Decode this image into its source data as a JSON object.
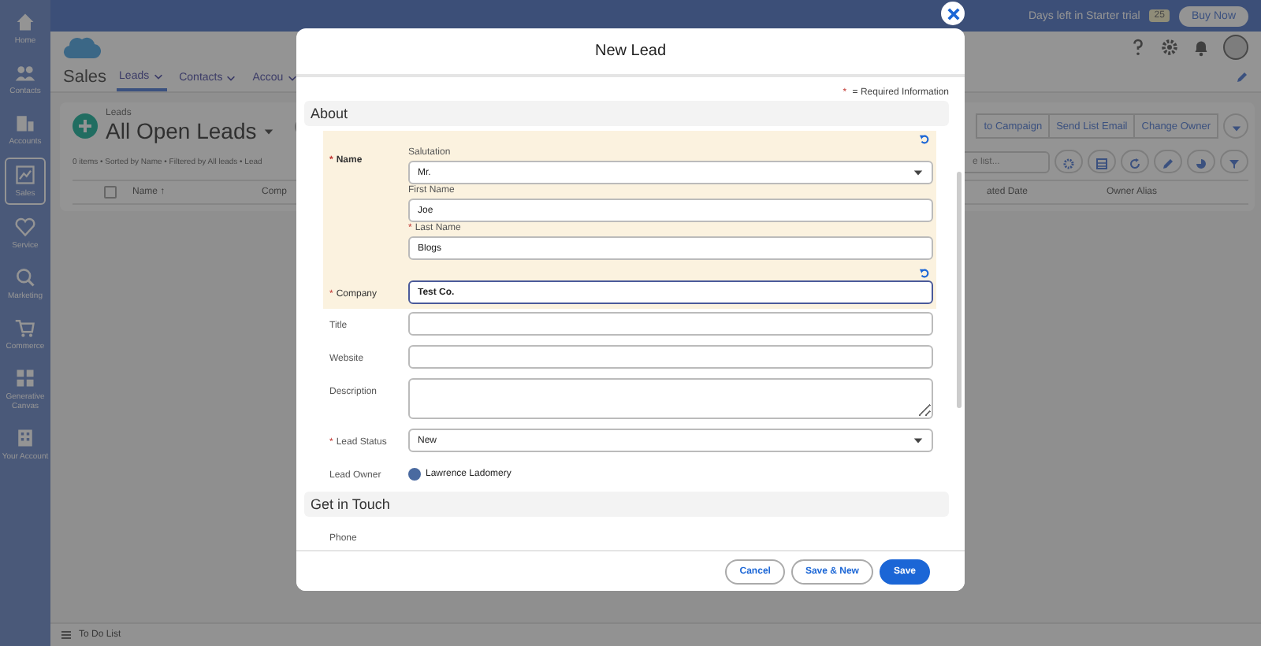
{
  "top_bar": {
    "trial_text": "Days left in Starter trial",
    "days": "25",
    "buy_button": "Buy Now"
  },
  "nav": {
    "items": [
      {
        "label": "Home",
        "selected": false
      },
      {
        "label": "Contacts",
        "selected": false
      },
      {
        "label": "Accounts",
        "selected": false
      },
      {
        "label": "Sales",
        "selected": true
      },
      {
        "label": "Service",
        "selected": false
      },
      {
        "label": "Marketing",
        "selected": false
      },
      {
        "label": "Commerce",
        "selected": false
      },
      {
        "label": "Generative Canvas",
        "selected": false
      },
      {
        "label": "Your Account",
        "selected": false
      }
    ]
  },
  "app": {
    "name": "Sales",
    "tabs": [
      {
        "label": "Leads",
        "selected": true
      },
      {
        "label": "Contacts",
        "selected": false
      },
      {
        "label": "Accou",
        "selected": false
      }
    ]
  },
  "list_view": {
    "object": "Leads",
    "title": "All Open Leads",
    "summary": "0 items • Sorted by Name • Filtered by All leads • Lead",
    "actions": [
      "to Campaign",
      "Send List Email",
      "Change Owner"
    ],
    "search": {
      "placeholder": "e list..."
    },
    "select_all": {
      "checked": false
    },
    "columns_left": [
      "Name ↑",
      "Comp"
    ],
    "columns_right": [
      "ated Date",
      "Owner Alias"
    ]
  },
  "modal": {
    "title": "New Lead",
    "required_note": {
      "mark": "*",
      "text": "= Required Information"
    },
    "sections": [
      {
        "title": "About",
        "fields": [
          {
            "kind": "compound",
            "label": "Name",
            "required_mark": "*",
            "edited": true,
            "subfields": [
              {
                "kind": "select",
                "label": "Salutation",
                "value": "Mr."
              },
              {
                "kind": "text",
                "label": "First Name",
                "value": "Joe"
              },
              {
                "kind": "text",
                "label": "Last Name",
                "required_mark": "*",
                "value": "Blogs"
              }
            ]
          },
          {
            "kind": "text",
            "label": "Company",
            "required_mark": "*",
            "value": "Test Co.",
            "edited": true,
            "focused": true
          },
          {
            "kind": "text",
            "label": "Title",
            "edited": false
          },
          {
            "kind": "text",
            "label": "Website",
            "edited": false
          },
          {
            "kind": "textarea",
            "label": "Description",
            "edited": false
          },
          {
            "kind": "select",
            "label": "Lead Status",
            "required_mark": "*",
            "value": "New",
            "edited": false
          },
          {
            "kind": "user",
            "label": "Lead Owner",
            "value": "Lawrence Ladomery",
            "edited": false
          }
        ]
      },
      {
        "title": "Get in Touch",
        "fields": [
          {
            "kind": "label_only",
            "label": "Phone",
            "edited": false
          }
        ]
      }
    ],
    "buttons": [
      {
        "label": "Cancel",
        "kind": "neutral"
      },
      {
        "label": "Save & New",
        "kind": "neutral"
      },
      {
        "label": "Save",
        "kind": "brand"
      }
    ]
  },
  "footer": {
    "label": "To Do List"
  }
}
